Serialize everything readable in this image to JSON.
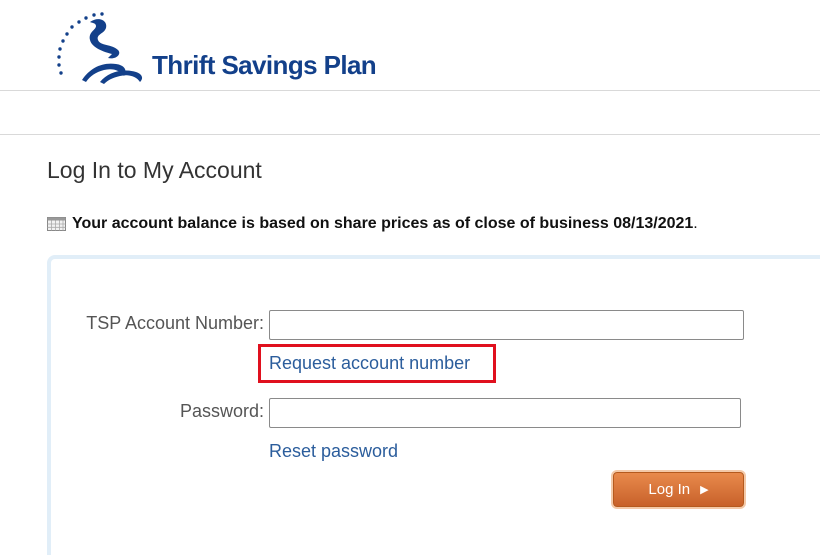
{
  "brand": {
    "name": "Thrift Savings Plan",
    "logo_color": "#13408a"
  },
  "page": {
    "title": "Log In to My Account"
  },
  "notice": {
    "icon": "calendar-icon",
    "text": "Your account balance is based on share prices as of close of business 08/13/2021",
    "trailing": "."
  },
  "form": {
    "account_label": "TSP Account Number:",
    "account_value": "",
    "request_link": "Request account number",
    "password_label": "Password:",
    "password_value": "",
    "reset_link": "Reset password",
    "login_label": "Log In",
    "login_arrow": "▶"
  },
  "colors": {
    "link": "#2b5d9c",
    "highlight": "#e0101e",
    "button": "#d9743a"
  }
}
